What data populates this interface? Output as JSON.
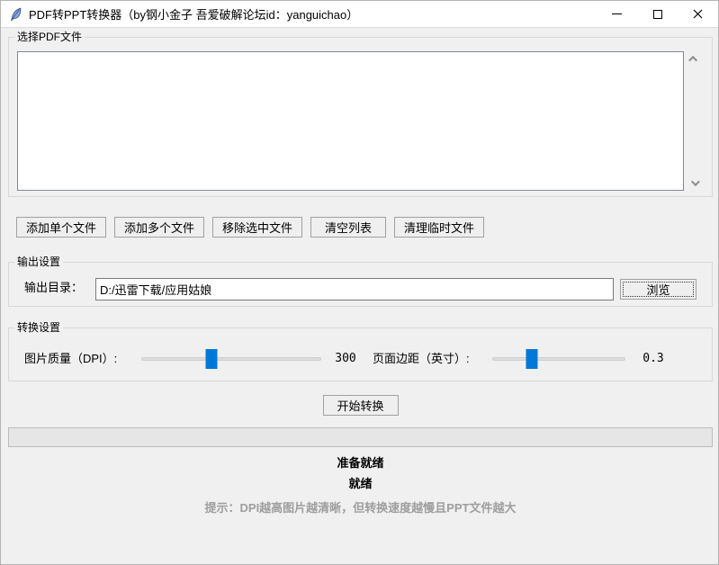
{
  "window": {
    "title": "PDF转PPT转换器（by钢小金子 吾爱破解论坛id：yanguichao）"
  },
  "file_section": {
    "label": "选择PDF文件",
    "items": []
  },
  "action_buttons": {
    "add_single": "添加单个文件",
    "add_multiple": "添加多个文件",
    "remove_selected": "移除选中文件",
    "clear_list": "清空列表",
    "clean_temp": "清理临时文件"
  },
  "output_section": {
    "label": "输出设置",
    "dir_label": "输出目录：",
    "dir_value": "D:/迅雷下载/应用姑娘",
    "browse_label": "浏览"
  },
  "convert_section": {
    "label": "转换设置",
    "dpi_label": "图片质量（DPI）:",
    "dpi_value": "300",
    "dpi_slider_percent": 39,
    "margin_label": "页面边距（英寸）:",
    "margin_value": "0.3",
    "margin_slider_percent": 30
  },
  "start_button": "开始转换",
  "progress": {
    "percent": 0
  },
  "status": {
    "primary": "准备就绪",
    "secondary": "就绪",
    "hint": "提示：DPI越高图片越清晰，但转换速度越慢且PPT文件越大"
  },
  "colors": {
    "accent": "#0078d7",
    "window_bg": "#f0f0f0",
    "titlebar_bg": "#ffffff",
    "hint_text": "#9e9e9e"
  }
}
